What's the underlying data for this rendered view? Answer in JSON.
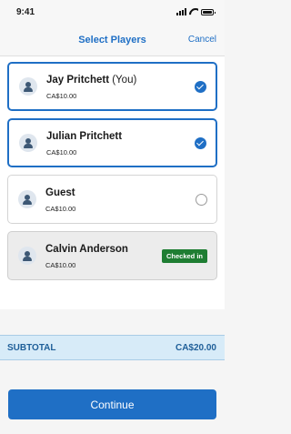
{
  "status_bar": {
    "time": "9:41"
  },
  "nav": {
    "title": "Select Players",
    "cancel": "Cancel"
  },
  "players": [
    {
      "name": "Jay Pritchett",
      "suffix": " (You)",
      "price": "CA$10.00",
      "state": "selected"
    },
    {
      "name": "Julian Pritchett",
      "suffix": "",
      "price": "CA$10.00",
      "state": "selected"
    },
    {
      "name": "Guest",
      "suffix": "",
      "price": "CA$10.00",
      "state": "unselected"
    },
    {
      "name": "Calvin Anderson",
      "suffix": "",
      "price": "CA$10.00",
      "state": "checked-in",
      "badge": "Checked in"
    }
  ],
  "subtotal": {
    "label": "SUBTOTAL",
    "value": "CA$20.00"
  },
  "continue_label": "Continue",
  "colors": {
    "accent": "#1f6fc5",
    "checked_in_badge": "#1e7d32",
    "subtotal_bg": "#d7ebf8"
  },
  "icons": {
    "avatar": "person-icon",
    "selected": "checkmark-circle-icon",
    "unselected": "radio-empty-icon"
  }
}
